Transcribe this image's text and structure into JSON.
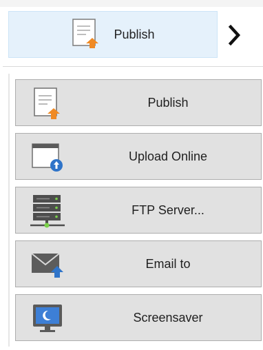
{
  "publish_tab": {
    "label": "Publish",
    "icon": "publish-document-icon",
    "accent_bg": "#e5f1fb"
  },
  "expand": {
    "icon": "chevron-right-icon"
  },
  "menu": {
    "items": [
      {
        "label": "Publish",
        "icon": "publish-document-icon"
      },
      {
        "label": "Upload Online",
        "icon": "upload-online-icon"
      },
      {
        "label": "FTP Server...",
        "icon": "ftp-server-icon"
      },
      {
        "label": "Email to",
        "icon": "email-icon"
      },
      {
        "label": "Screensaver",
        "icon": "screensaver-icon"
      }
    ]
  },
  "colors": {
    "button_bg": "#e1e1e1",
    "button_border": "#adadad",
    "orange_accent": "#f08a24",
    "blue_accent": "#2f74c9"
  }
}
